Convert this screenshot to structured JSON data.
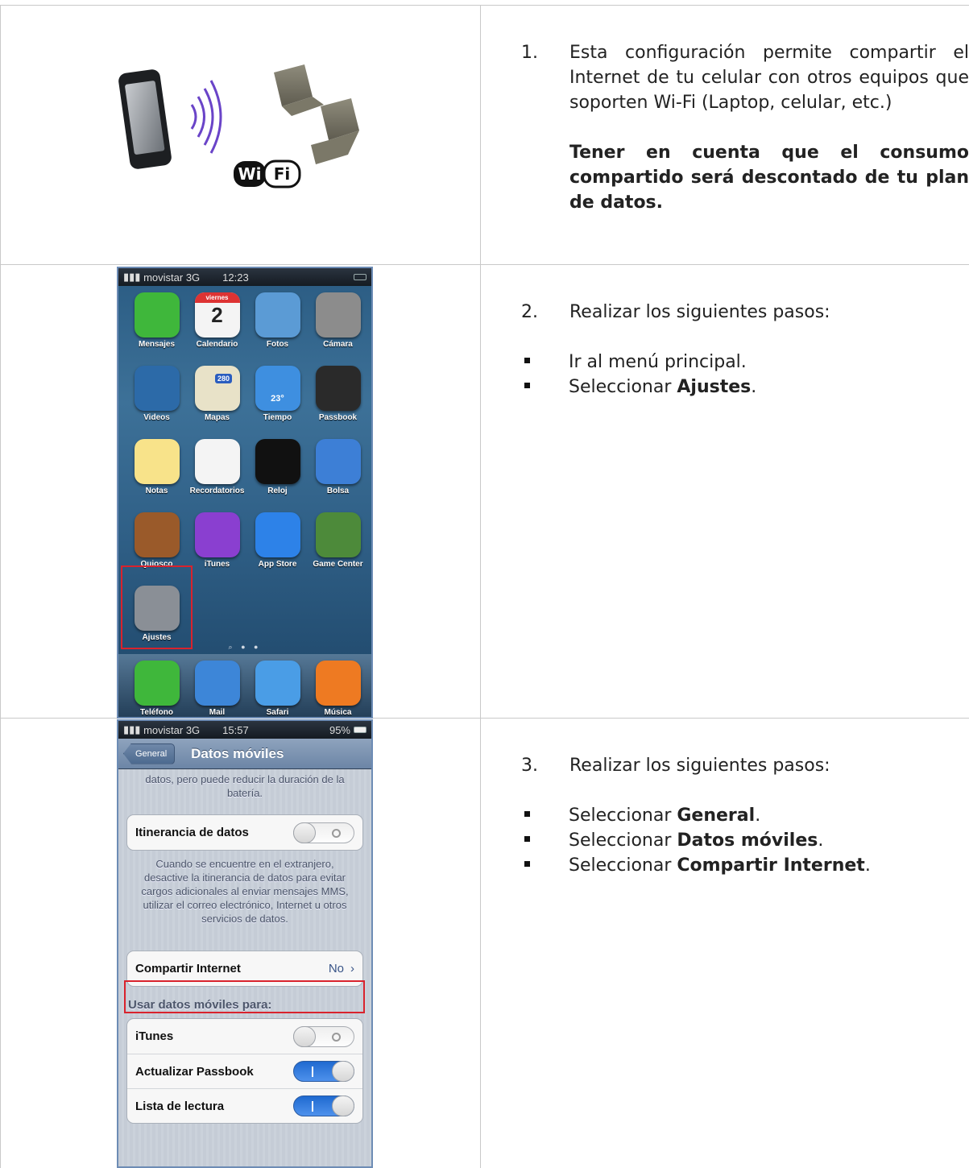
{
  "step1": {
    "number": "1.",
    "text": "Esta configuración permite compartir el Internet de tu celular con otros equipos que soporten Wi-Fi (Laptop, celular, etc.)",
    "warning": "Tener en cuenta que el consumo compartido será descontado de tu plan de datos.",
    "wifi_logo": "WiFi"
  },
  "step2": {
    "number": "2.",
    "intro": "Realizar los siguientes pasos:",
    "bullets": [
      {
        "pre": "Ir al menú principal.",
        "bold": "",
        "post": ""
      },
      {
        "pre": "Seleccionar ",
        "bold": "Ajustes",
        "post": "."
      }
    ]
  },
  "step3": {
    "number": "3.",
    "intro": "Realizar los siguientes pasos:",
    "bullets": [
      {
        "pre": "Seleccionar ",
        "bold": "General",
        "post": "."
      },
      {
        "pre": "Seleccionar ",
        "bold": "Datos móviles",
        "post": "."
      },
      {
        "pre": "Seleccionar ",
        "bold": "Compartir Internet",
        "post": "."
      }
    ]
  },
  "home_screen": {
    "carrier": "movistar",
    "network": "3G",
    "time": "12:23",
    "calendar_day": "viernes",
    "calendar_date": "2",
    "maps_shield": "280",
    "weather_temp": "23°",
    "apps": [
      {
        "label": "Mensajes",
        "icon": "messages-icon",
        "color": "#3fb73b"
      },
      {
        "label": "Calendario",
        "icon": "calendar-icon",
        "color": "#f4f4f4"
      },
      {
        "label": "Fotos",
        "icon": "photos-icon",
        "color": "#5b9bd5"
      },
      {
        "label": "Cámara",
        "icon": "camera-icon",
        "color": "#8c8c8c"
      },
      {
        "label": "Videos",
        "icon": "videos-icon",
        "color": "#2c6aa8"
      },
      {
        "label": "Mapas",
        "icon": "maps-icon",
        "color": "#e8e2c8"
      },
      {
        "label": "Tiempo",
        "icon": "weather-icon",
        "color": "#3e8fe0"
      },
      {
        "label": "Passbook",
        "icon": "passbook-icon",
        "color": "#2a2a2a"
      },
      {
        "label": "Notas",
        "icon": "notes-icon",
        "color": "#f8e38a"
      },
      {
        "label": "Recordatorios",
        "icon": "reminders-icon",
        "color": "#f4f4f4"
      },
      {
        "label": "Reloj",
        "icon": "clock-icon",
        "color": "#111111"
      },
      {
        "label": "Bolsa",
        "icon": "stocks-icon",
        "color": "#3d7fd6"
      },
      {
        "label": "Quiosco",
        "icon": "newsstand-icon",
        "color": "#9a5a2a"
      },
      {
        "label": "iTunes",
        "icon": "itunes-icon",
        "color": "#8a3fd0"
      },
      {
        "label": "App Store",
        "icon": "app-store-icon",
        "color": "#2d82e8"
      },
      {
        "label": "Game Center",
        "icon": "game-center-icon",
        "color": "#4d8a3a"
      },
      {
        "label": "Ajustes",
        "icon": "settings-gear-icon",
        "color": "#8a8f96"
      }
    ],
    "dock": [
      {
        "label": "Teléfono",
        "icon": "phone-icon",
        "color": "#3fb73b"
      },
      {
        "label": "Mail",
        "icon": "mail-icon",
        "color": "#3d86d8"
      },
      {
        "label": "Safari",
        "icon": "safari-icon",
        "color": "#4a9de6"
      },
      {
        "label": "Música",
        "icon": "music-icon",
        "color": "#ee7a22"
      }
    ]
  },
  "settings_screen": {
    "carrier": "movistar",
    "network": "3G",
    "time": "15:57",
    "battery": "95%",
    "back_label": "General",
    "title": "Datos móviles",
    "top_note": "datos, pero puede reducir la duración de la batería.",
    "roaming_label": "Itinerancia de datos",
    "roaming_note": "Cuando se encuentre en el extranjero, desactive la itinerancia de datos para evitar cargos adicionales al enviar mensajes MMS, utilizar el correo electrónico, Internet u otros servicios de datos.",
    "tethering_label": "Compartir Internet",
    "tethering_value": "No",
    "section_header": "Usar datos móviles para:",
    "usage_rows": [
      {
        "label": "iTunes",
        "on": false
      },
      {
        "label": "Actualizar Passbook",
        "on": true
      },
      {
        "label": "Lista de lectura",
        "on": true
      }
    ]
  },
  "colors": {
    "highlight_red": "#d9232d",
    "grid_line": "#c9c9c9"
  }
}
